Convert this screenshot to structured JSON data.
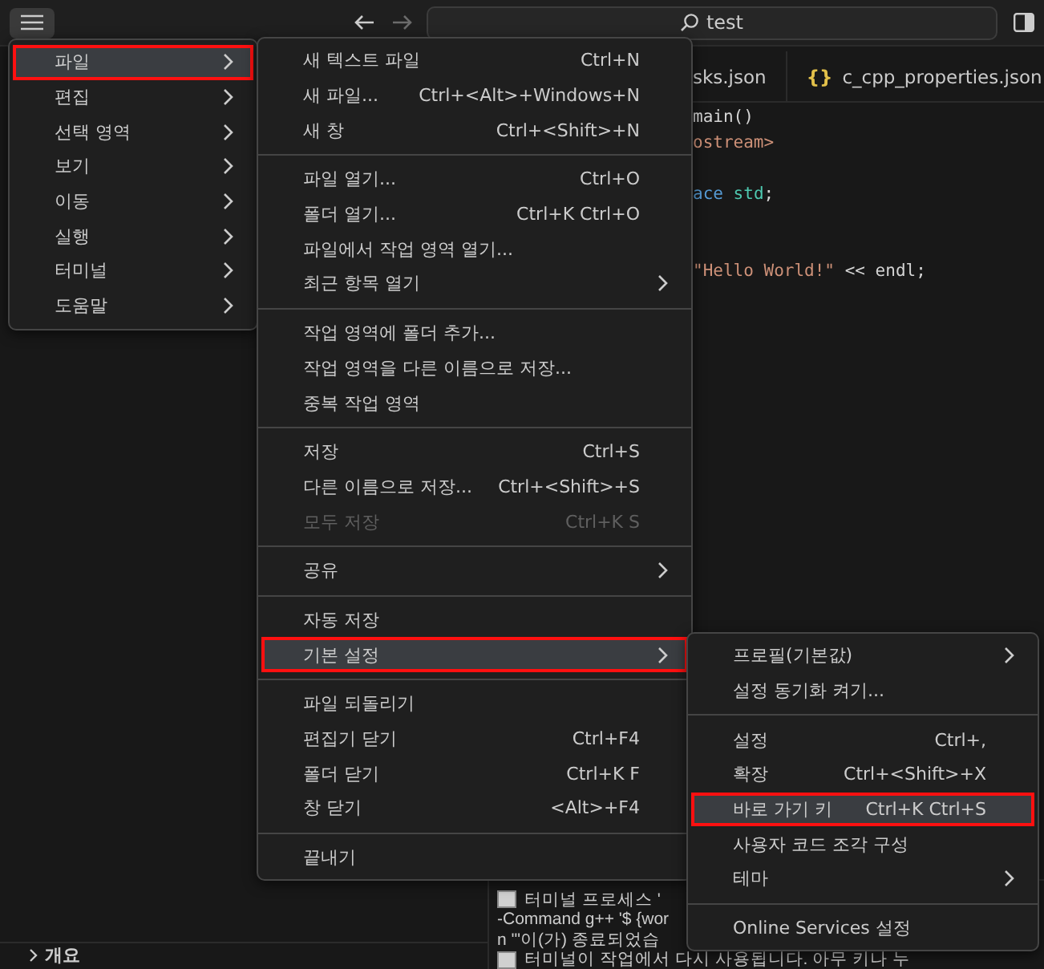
{
  "title_bar": {
    "search_value": "test"
  },
  "editor": {
    "tabs": [
      {
        "label": "sks.json"
      },
      {
        "label": "c_cpp_properties.json",
        "icon": "{}"
      }
    ],
    "code_lines": [
      {
        "kind": "code",
        "tokens": [
          {
            "text": "main()",
            "kind": "plain"
          }
        ]
      },
      {
        "kind": "code",
        "tokens": [
          {
            "text": "ostream>",
            "kind": "string"
          }
        ]
      },
      {
        "kind": "blank"
      },
      {
        "kind": "code",
        "tokens": [
          {
            "text": "ace ",
            "kind": "keyword"
          },
          {
            "text": "std",
            "kind": "type"
          },
          {
            "text": ";",
            "kind": "plain"
          }
        ]
      },
      {
        "kind": "blank"
      },
      {
        "kind": "blank"
      },
      {
        "kind": "code",
        "tokens": [
          {
            "text": "\"Hello World!\"",
            "kind": "string"
          },
          {
            "text": " << endl;",
            "kind": "plain"
          }
        ]
      }
    ]
  },
  "terminal": {
    "lines": [
      {
        "kind": "notice",
        "text": "터미널 프로세스 '"
      },
      {
        "kind": "text",
        "text": "-Command g++ '$ {wor"
      },
      {
        "kind": "text",
        "text": "n '\"이(가) 종료되었습"
      },
      {
        "kind": "notice",
        "text": "터미널이 작업에서 다시 사용됩니다. 아무 키나 누"
      }
    ]
  },
  "sidebar": {
    "sections": [
      {
        "label": "개요",
        "expanded": false
      }
    ]
  },
  "menu_bar": {
    "items": [
      {
        "label": "파일",
        "selected": true
      },
      {
        "label": "편집",
        "selected": false
      },
      {
        "label": "선택 영역",
        "selected": false
      },
      {
        "label": "보기",
        "selected": false
      },
      {
        "label": "이동",
        "selected": false
      },
      {
        "label": "실행",
        "selected": false
      },
      {
        "label": "터미널",
        "selected": false
      },
      {
        "label": "도움말",
        "selected": false
      }
    ]
  },
  "file_menu": {
    "groups": [
      {
        "items": [
          {
            "label": "새 텍스트 파일",
            "shortcut": "Ctrl+N",
            "submenu": false,
            "disabled": false,
            "selected": false
          },
          {
            "label": "새 파일...",
            "shortcut": "Ctrl+<Alt>+Windows+N",
            "submenu": false,
            "disabled": false,
            "selected": false
          },
          {
            "label": "새 창",
            "shortcut": "Ctrl+<Shift>+N",
            "submenu": false,
            "disabled": false,
            "selected": false
          }
        ]
      },
      {
        "items": [
          {
            "label": "파일 열기...",
            "shortcut": "Ctrl+O",
            "submenu": false,
            "disabled": false,
            "selected": false
          },
          {
            "label": "폴더 열기...",
            "shortcut": "Ctrl+K Ctrl+O",
            "submenu": false,
            "disabled": false,
            "selected": false
          },
          {
            "label": "파일에서 작업 영역 열기...",
            "submenu": false,
            "disabled": false,
            "selected": false
          },
          {
            "label": "최근 항목 열기",
            "submenu": true,
            "disabled": false,
            "selected": false
          }
        ]
      },
      {
        "items": [
          {
            "label": "작업 영역에 폴더 추가...",
            "submenu": false,
            "disabled": false,
            "selected": false
          },
          {
            "label": "작업 영역을 다른 이름으로 저장...",
            "submenu": false,
            "disabled": false,
            "selected": false
          },
          {
            "label": "중복 작업 영역",
            "submenu": false,
            "disabled": false,
            "selected": false
          }
        ]
      },
      {
        "items": [
          {
            "label": "저장",
            "shortcut": "Ctrl+S",
            "submenu": false,
            "disabled": false,
            "selected": false
          },
          {
            "label": "다른 이름으로 저장...",
            "shortcut": "Ctrl+<Shift>+S",
            "submenu": false,
            "disabled": false,
            "selected": false
          },
          {
            "label": "모두 저장",
            "shortcut": "Ctrl+K S",
            "submenu": false,
            "disabled": true,
            "selected": false
          }
        ]
      },
      {
        "items": [
          {
            "label": "공유",
            "submenu": true,
            "disabled": false,
            "selected": false
          }
        ]
      },
      {
        "items": [
          {
            "label": "자동 저장",
            "submenu": false,
            "disabled": false,
            "selected": false
          },
          {
            "label": "기본 설정",
            "submenu": true,
            "disabled": false,
            "selected": true
          }
        ]
      },
      {
        "items": [
          {
            "label": "파일 되돌리기",
            "submenu": false,
            "disabled": false,
            "selected": false
          },
          {
            "label": "편집기 닫기",
            "shortcut": "Ctrl+F4",
            "submenu": false,
            "disabled": false,
            "selected": false
          },
          {
            "label": "폴더 닫기",
            "shortcut": "Ctrl+K F",
            "submenu": false,
            "disabled": false,
            "selected": false
          },
          {
            "label": "창 닫기",
            "shortcut": "<Alt>+F4",
            "submenu": false,
            "disabled": false,
            "selected": false
          }
        ]
      },
      {
        "items": [
          {
            "label": "끝내기",
            "submenu": false,
            "disabled": false,
            "selected": false
          }
        ]
      }
    ]
  },
  "preferences_menu": {
    "groups": [
      {
        "items": [
          {
            "label": "프로필(기본값)",
            "submenu": true,
            "disabled": false,
            "selected": false
          },
          {
            "label": "설정 동기화 켜기...",
            "submenu": false,
            "disabled": false,
            "selected": false
          }
        ]
      },
      {
        "items": [
          {
            "label": "설정",
            "shortcut": "Ctrl+,",
            "submenu": false,
            "disabled": false,
            "selected": false
          },
          {
            "label": "확장",
            "shortcut": "Ctrl+<Shift>+X",
            "submenu": false,
            "disabled": false,
            "selected": false
          },
          {
            "label": "바로 가기 키",
            "shortcut": "Ctrl+K Ctrl+S",
            "submenu": false,
            "disabled": false,
            "selected": true
          },
          {
            "label": "사용자 코드 조각 구성",
            "submenu": false,
            "disabled": false,
            "selected": false
          },
          {
            "label": "테마",
            "submenu": true,
            "disabled": false,
            "selected": false
          }
        ]
      },
      {
        "items": [
          {
            "label": "Online Services 설정",
            "submenu": false,
            "disabled": false,
            "selected": false
          }
        ]
      }
    ]
  }
}
